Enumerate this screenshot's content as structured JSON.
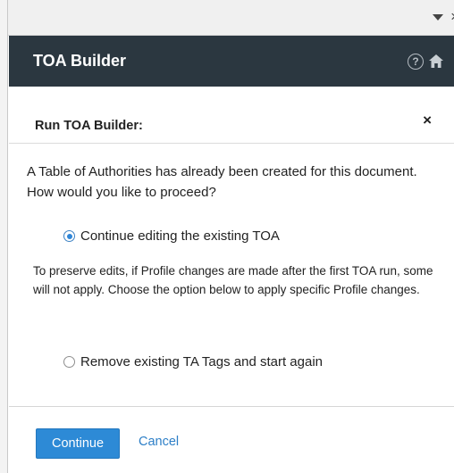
{
  "header": {
    "title": "TOA Builder",
    "help_glyph": "?"
  },
  "dialog": {
    "title": "Run TOA Builder:",
    "close_glyph": "×",
    "prompt": "A Table of Authorities has already been created for this document. How would you like to proceed?",
    "options": [
      {
        "label": "Continue editing the existing TOA",
        "selected": true
      },
      {
        "label": "Remove existing TA Tags and start again",
        "selected": false
      }
    ],
    "note": "To preserve edits, if Profile changes are made after the first TOA run, some will not apply. Choose the option below to apply specific Profile changes.",
    "continue_label": "Continue",
    "cancel_label": "Cancel"
  },
  "icons": [
    "caret-down-icon",
    "close-icon",
    "help-icon",
    "home-icon"
  ],
  "colors": {
    "header_bg": "#2b3740",
    "primary": "#2d8ad6",
    "link": "#2d7fc7"
  }
}
